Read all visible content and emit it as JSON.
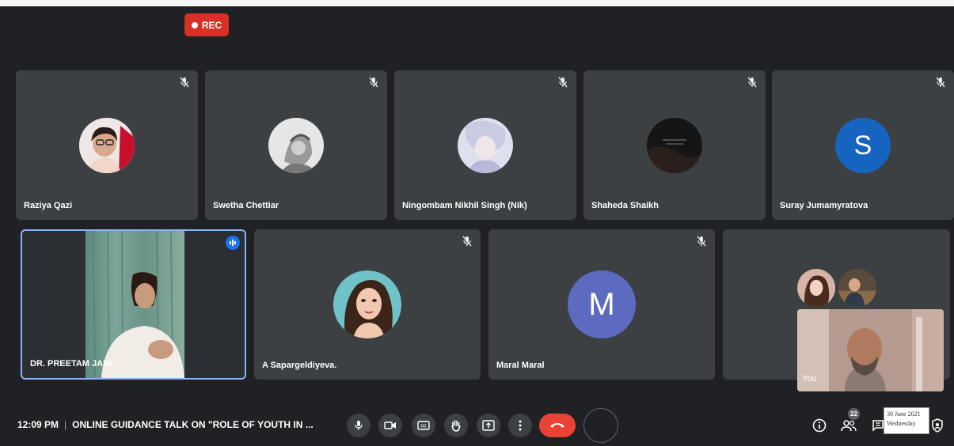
{
  "header_text": "…",
  "recording": {
    "label": "REC"
  },
  "participants_row1": [
    {
      "name": "Raziya Qazi"
    },
    {
      "name": "Swetha Chettiar"
    },
    {
      "name": "Ningombam Nikhil Singh (Nik)"
    },
    {
      "name": "Shaheda Shaikh"
    },
    {
      "name": "Suray Jumamyratova",
      "initial": "S"
    }
  ],
  "participants_row2": [
    {
      "name": "DR. PREETAM JAIN"
    },
    {
      "name": "A Sapargeldiyeva."
    },
    {
      "name": "Maral Maral",
      "initial": "M"
    }
  ],
  "self_view": {
    "name": "You"
  },
  "meeting": {
    "time": "12:09 PM",
    "title": "ONLINE GUIDANCE TALK ON \"ROLE OF YOUTH IN ..."
  },
  "people_count": "22",
  "tooltip": {
    "date": "30 June 2021",
    "day": "Wednesday"
  },
  "colors": {
    "background": "#202124",
    "tile": "#3c4043",
    "rec": "#d93025",
    "end_call": "#ea4335",
    "speaker_border": "#8ab4f8",
    "avatar_s": "#1565c0",
    "avatar_m": "#5c6bc0"
  },
  "icons": [
    "mic-off-icon",
    "mic-icon",
    "camera-icon",
    "captions-icon",
    "raise-hand-icon",
    "present-icon",
    "more-options-icon",
    "end-call-icon",
    "info-icon",
    "people-icon",
    "chat-icon",
    "activities-icon",
    "host-controls-icon"
  ]
}
